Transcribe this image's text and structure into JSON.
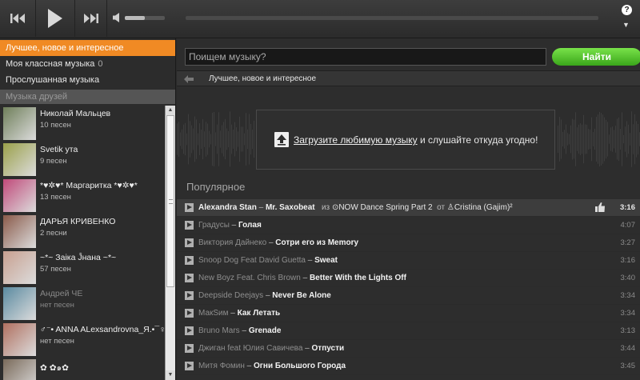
{
  "player": {
    "prev_icon": "previous-track-icon",
    "play_icon": "play-icon",
    "next_icon": "next-track-icon",
    "volume_icon": "speaker-icon",
    "volume_level": 0.5,
    "help_label": "?",
    "collapse_label": "▼"
  },
  "sidebar": {
    "nav": [
      {
        "label": "Лучшее, новое и интересное",
        "count": ""
      },
      {
        "label": "Моя классная музыка",
        "count": "0"
      },
      {
        "label": "Прослушанная музыка",
        "count": ""
      }
    ],
    "friends_header": "Музыка друзей",
    "friends": [
      {
        "name": "Николай Мальцев",
        "count": "10 песен",
        "avatar_color": "#6f7f5a"
      },
      {
        "name": "Svetik ута",
        "count": "9 песен",
        "avatar_color": "#9aa04a"
      },
      {
        "name": "*♥✲♥* Маргаритка *♥✲♥*",
        "count": "13 песен",
        "avatar_color": "#c04a7a"
      },
      {
        "name": "ДАРЬЯ КРИВЕНКО",
        "count": "2 песни",
        "avatar_color": "#8a5a4a"
      },
      {
        "name": "~*~ Заiка Ĵнана ~*~",
        "count": "57 песен",
        "avatar_color": "#c8a090"
      },
      {
        "name": "Андрей ЧЕ",
        "count": "нет песен",
        "avatar_color": "#5a8aa0"
      },
      {
        "name": "♂⁻• ANNA ALexsandrovna_Я.•¯♀_☿",
        "count": "нет песен",
        "avatar_color": "#b07060"
      },
      {
        "name": "✿ ✿๑✿",
        "count": "",
        "avatar_color": "#7a6a5a"
      }
    ]
  },
  "search": {
    "placeholder": "Поищем музыку?",
    "button_label": "Найти"
  },
  "breadcrumb": "Лучшее, новое и интересное",
  "upload": {
    "link_text": "Загрузите любимую музыку",
    "rest_text": " и слушайте откуда угодно!"
  },
  "popular": {
    "title": "Популярное",
    "tracks": [
      {
        "artist": "Alexandra Stan",
        "title": "Mr. Saxobeat",
        "from_label": "из",
        "album": "NOW Dance Spring Part 2",
        "by_label": "от",
        "user": "Cristina (Gajim)²",
        "duration": "3:16",
        "active": true
      },
      {
        "artist": "Градусы",
        "title": "Голая",
        "duration": "4:07"
      },
      {
        "artist": "Виктория Дайнеко",
        "title": "Сотри его из Memory",
        "duration": "3:27"
      },
      {
        "artist": "Snoop Dog Feat David Guetta",
        "title": "Sweat",
        "duration": "3:16"
      },
      {
        "artist": "New Boyz Feat. Chris Brown",
        "title": "Better With the Lights Off",
        "duration": "3:40"
      },
      {
        "artist": "Deepside Deejays",
        "title": "Never Be Alone",
        "duration": "3:34"
      },
      {
        "artist": "МакSим",
        "title": "Как Летать",
        "duration": "3:34"
      },
      {
        "artist": "Bruno Mars",
        "title": "Grenade",
        "duration": "3:13"
      },
      {
        "artist": "Джиган feat Юлия Савичева",
        "title": "Отпусти",
        "duration": "3:44"
      },
      {
        "artist": "Митя Фомин",
        "title": "Огни Большого Города",
        "duration": "3:45"
      }
    ]
  }
}
